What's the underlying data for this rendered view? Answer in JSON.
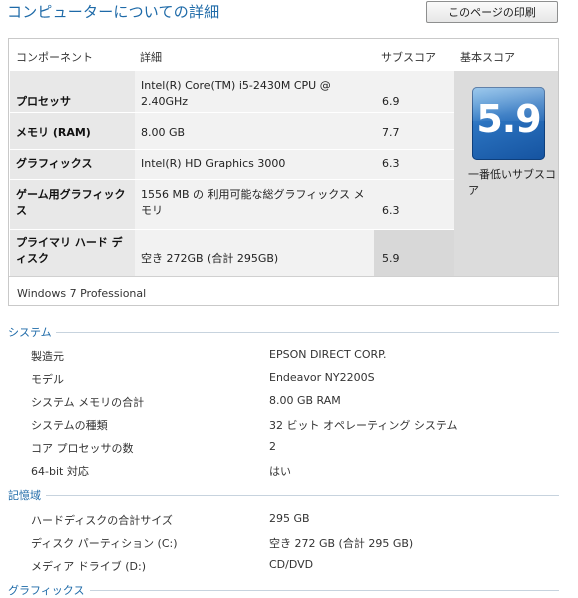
{
  "header": {
    "title": "コンピューターについての詳細",
    "print_button": "このページの印刷"
  },
  "score_table": {
    "headers": {
      "component": "コンポーネント",
      "details": "詳細",
      "subscore": "サブスコア",
      "base_score": "基本スコア"
    },
    "rows": [
      {
        "component": "プロセッサ",
        "details": "Intel(R) Core(TM) i5-2430M CPU @ 2.40GHz",
        "subscore": "6.9"
      },
      {
        "component": "メモリ (RAM)",
        "details": "8.00 GB",
        "subscore": "7.7"
      },
      {
        "component": "グラフィックス",
        "details": "Intel(R) HD Graphics 3000",
        "subscore": "6.3"
      },
      {
        "component": "ゲーム用グラフィックス",
        "details": "1556 MB の 利用可能な総グラフィックス メモリ",
        "subscore": "6.3"
      },
      {
        "component": "プライマリ ハード ディスク",
        "details": "空き 272GB (合計 295GB)",
        "subscore": "5.9"
      }
    ],
    "base_score": "5.9",
    "base_score_note": "一番低いサブスコア",
    "edition": "Windows 7 Professional"
  },
  "system": {
    "heading": "システム",
    "items": [
      {
        "label": "製造元",
        "value": "EPSON DIRECT CORP."
      },
      {
        "label": "モデル",
        "value": "Endeavor NY2200S"
      },
      {
        "label": "システム メモリの合計",
        "value": "8.00 GB RAM"
      },
      {
        "label": "システムの種類",
        "value": "32 ビット オペレーティング システム"
      },
      {
        "label": "コア プロセッサの数",
        "value": "2"
      },
      {
        "label": "64-bit 対応",
        "value": "はい"
      }
    ]
  },
  "storage": {
    "heading": "記憶域",
    "items": [
      {
        "label": "ハードディスクの合計サイズ",
        "value": "295 GB"
      },
      {
        "label": "ディスク パーティション (C:)",
        "value": "空き 272 GB (合計 295 GB)"
      },
      {
        "label": "メディア ドライブ (D:)",
        "value": "CD/DVD"
      }
    ]
  },
  "graphics": {
    "heading": "グラフィックス"
  }
}
